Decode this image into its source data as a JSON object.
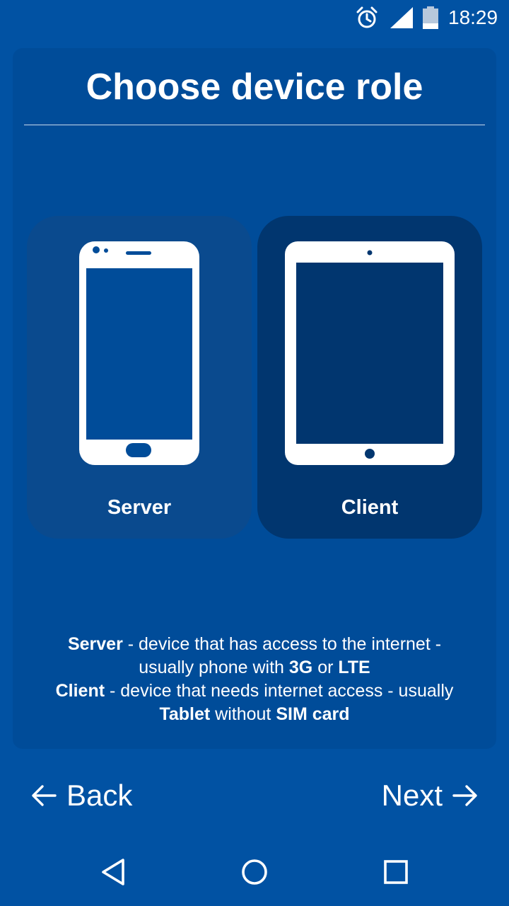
{
  "status_bar": {
    "time": "18:29",
    "icons": [
      "alarm-icon",
      "cell-signal-icon",
      "battery-icon"
    ]
  },
  "title": "Choose device role",
  "roles": [
    {
      "id": "server",
      "label": "Server",
      "icon": "phone-icon",
      "selected": false
    },
    {
      "id": "client",
      "label": "Client",
      "icon": "tablet-icon",
      "selected": true
    }
  ],
  "description": {
    "line1": {
      "term": "Server",
      "text": " - device that has access to the internet -"
    },
    "line2": {
      "text_before": "usually phone with ",
      "term1": "3G",
      "text_mid": " or ",
      "term2": "LTE"
    },
    "line3": {
      "term": "Client",
      "text": " - device that needs internet access - usually"
    },
    "line4": {
      "term1": "Tablet",
      "text_mid": " without ",
      "term2": "SIM card"
    }
  },
  "nav": {
    "back_label": "Back",
    "next_label": "Next"
  },
  "system_nav": [
    "back-triangle-icon",
    "home-circle-icon",
    "recents-square-icon"
  ],
  "colors": {
    "background": "#0152a3",
    "panel": "#004c99",
    "server_card": "#0a4a8e",
    "client_card_selected": "#01366f",
    "text": "#ffffff"
  }
}
